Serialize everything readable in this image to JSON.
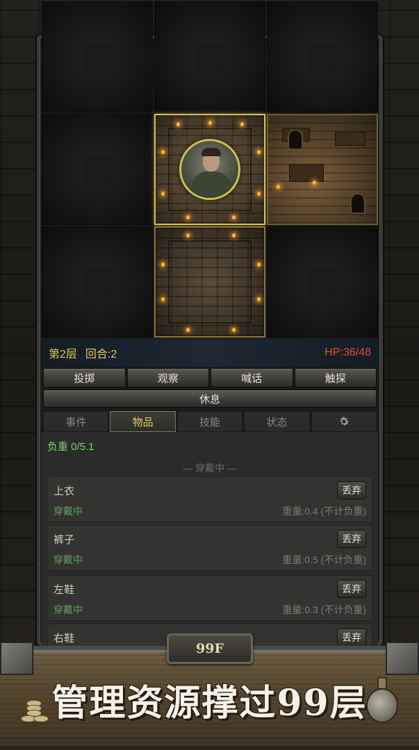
{
  "map": {
    "rooms": [
      {
        "name": "room-current",
        "type": "active"
      },
      {
        "name": "room-shop",
        "type": "shop"
      },
      {
        "name": "room-corridor",
        "type": "plain"
      }
    ]
  },
  "status": {
    "floor_label": "第2层",
    "round_label": "回合:2",
    "hp_label": "HP:36/48",
    "hp_color": "#e24a3e",
    "accent_color": "#e5c45a"
  },
  "actions": {
    "throw": "投掷",
    "observe": "观察",
    "shout": "喊话",
    "touch": "触探",
    "rest": "休息"
  },
  "tabs": [
    {
      "label": "事件",
      "active": false
    },
    {
      "label": "物品",
      "active": true
    },
    {
      "label": "技能",
      "active": false
    },
    {
      "label": "状态",
      "active": false
    },
    {
      "icon": "gear-icon",
      "active": false
    }
  ],
  "inventory": {
    "load_label": "负重 0/5.1",
    "section_title": "— 穿戴中 —",
    "items": [
      {
        "name": "上衣",
        "state": "穿戴中",
        "weight": "重量:0.4 (不计负重)",
        "action": "丢弃"
      },
      {
        "name": "裤子",
        "state": "穿戴中",
        "weight": "重量:0.5 (不计负重)",
        "action": "丢弃"
      },
      {
        "name": "左鞋",
        "state": "穿戴中",
        "weight": "重量:0.3 (不计负重)",
        "action": "丢弃"
      },
      {
        "name": "右鞋",
        "state": "",
        "weight": "",
        "action": "丢弃"
      }
    ]
  },
  "banner": {
    "floor_badge": "99F",
    "slogan": "管理资源撑过99层"
  }
}
